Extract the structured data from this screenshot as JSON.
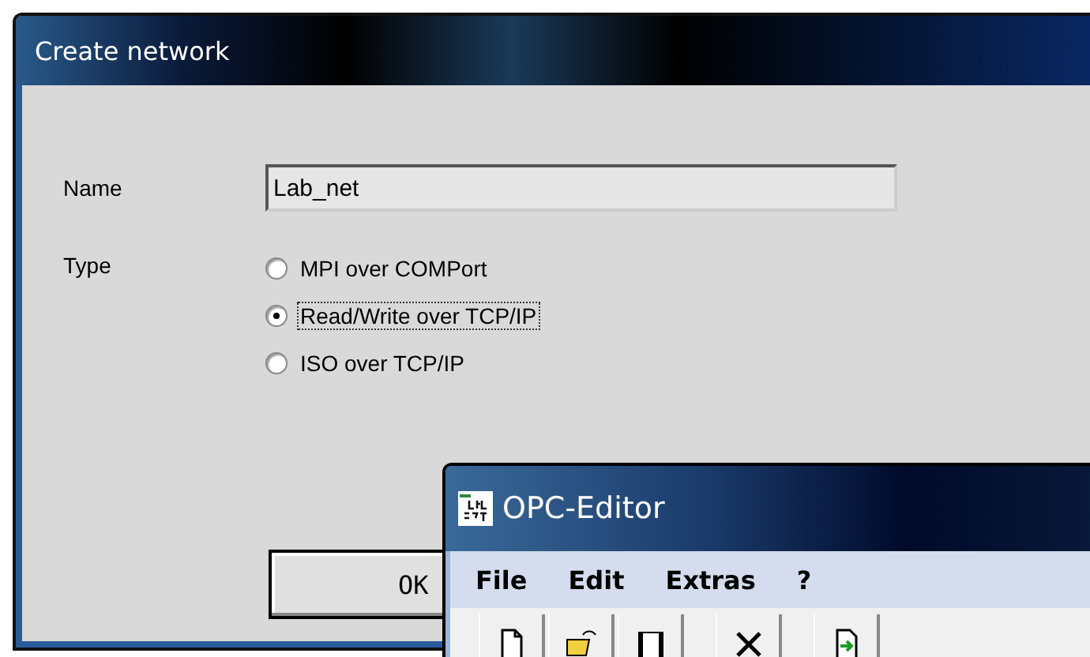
{
  "dialog": {
    "title": "Create network",
    "name_field": {
      "label": "Name",
      "value": "Lab_net"
    },
    "type_group": {
      "label": "Type",
      "options": [
        {
          "label": "MPI over COMPort",
          "selected": false,
          "focused": false
        },
        {
          "label": "Read/Write over TCP/IP",
          "selected": true,
          "focused": true
        },
        {
          "label": "ISO over TCP/IP",
          "selected": false,
          "focused": false
        }
      ]
    },
    "buttons": [
      "OK"
    ]
  },
  "editor_window": {
    "title": "OPC-Editor",
    "menu": [
      "File",
      "Edit",
      "Extras",
      "?"
    ],
    "toolbar": [
      {
        "kind": "new"
      },
      {
        "kind": "open"
      },
      {
        "kind": "save"
      },
      {
        "kind": "cut"
      },
      {
        "kind": "export"
      }
    ]
  }
}
